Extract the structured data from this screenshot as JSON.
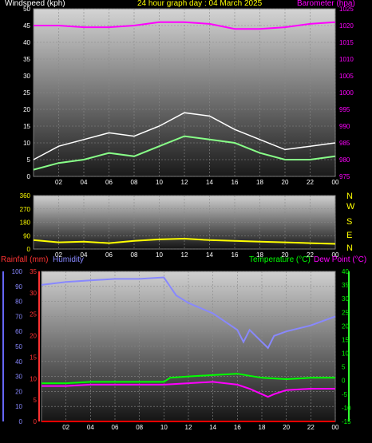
{
  "header": {
    "left": "Windspeed (kph)",
    "center": "24 hour graph day : 04 March 2025",
    "right": "Barometer (hpa)"
  },
  "lower_header": {
    "rain": "Rainfall (mm)",
    "humidity": "Humidity",
    "temperature": "Temperature (°C)",
    "dewpoint": "Dew Point (°C)"
  },
  "compass": [
    "N",
    "W",
    "S",
    "E",
    "N"
  ],
  "colors": {
    "background": "#000000",
    "wind_avg": "#ffffff",
    "wind_gust": "#88ff88",
    "barometer": "#ff00ff",
    "direction": "#ffff00",
    "humidity": "#8888ff",
    "temperature": "#00ff00",
    "dewpoint": "#ff00ff",
    "rain": "#ff0000",
    "axis_left_label": "#ffffff",
    "axis_right_label": "#ff00ff"
  },
  "chart_data": [
    {
      "type": "line",
      "name": "wind_and_pressure",
      "x_ticks": [
        "02",
        "04",
        "06",
        "08",
        "10",
        "12",
        "14",
        "16",
        "18",
        "20",
        "22",
        "00"
      ],
      "y_left": {
        "label": "Windspeed (kph)",
        "ylim": [
          0,
          50
        ],
        "ticks": [
          0,
          5,
          10,
          15,
          20,
          25,
          30,
          35,
          40,
          45,
          50
        ]
      },
      "y_right": {
        "label": "Barometer (hpa)",
        "ylim": [
          975,
          1025
        ],
        "ticks": [
          975,
          980,
          985,
          990,
          995,
          1000,
          1005,
          1010,
          1015,
          1020,
          1025
        ]
      },
      "series": [
        {
          "name": "Barometer",
          "axis": "right",
          "x": [
            0,
            2,
            4,
            6,
            8,
            10,
            12,
            14,
            16,
            18,
            20,
            22,
            24
          ],
          "values": [
            1020,
            1020,
            1019.5,
            1019.5,
            1020,
            1021,
            1021,
            1020.5,
            1019,
            1019,
            1019.5,
            1020.5,
            1021
          ]
        },
        {
          "name": "Windspeed",
          "axis": "left",
          "x": [
            0,
            2,
            4,
            6,
            8,
            10,
            12,
            14,
            16,
            18,
            20,
            22,
            24
          ],
          "values": [
            2,
            4,
            5,
            7,
            6,
            9,
            12,
            11,
            10,
            7,
            5,
            5,
            6
          ]
        },
        {
          "name": "Windspeed (gust)",
          "axis": "left",
          "x": [
            0,
            2,
            4,
            6,
            8,
            10,
            12,
            14,
            16,
            18,
            20,
            22,
            24
          ],
          "values": [
            5,
            9,
            11,
            13,
            12,
            15,
            19,
            18,
            14,
            11,
            8,
            9,
            10
          ]
        }
      ]
    },
    {
      "type": "line",
      "name": "wind_direction",
      "x_ticks": [
        "02",
        "04",
        "06",
        "08",
        "10",
        "12",
        "14",
        "16",
        "18",
        "20",
        "22",
        "00"
      ],
      "y_left": {
        "ylim": [
          0,
          360
        ],
        "ticks": [
          0,
          90,
          180,
          270,
          360
        ]
      },
      "series": [
        {
          "name": "Direction",
          "x": [
            0,
            2,
            4,
            6,
            8,
            10,
            12,
            14,
            16,
            18,
            20,
            22,
            24
          ],
          "values": [
            60,
            45,
            50,
            40,
            55,
            65,
            70,
            60,
            55,
            50,
            45,
            40,
            35
          ]
        }
      ]
    },
    {
      "type": "line",
      "name": "temp_humidity_rain",
      "x_ticks": [
        "02",
        "04",
        "06",
        "08",
        "10",
        "12",
        "14",
        "16",
        "18",
        "20",
        "22",
        "00"
      ],
      "y_left_outer": {
        "label": "Humidity",
        "ylim": [
          0,
          100
        ],
        "ticks": [
          0,
          10,
          20,
          30,
          40,
          50,
          60,
          70,
          80,
          90,
          100
        ]
      },
      "y_left_inner": {
        "label": "Rainfall (mm)",
        "ylim": [
          0,
          35
        ],
        "ticks": [
          0,
          5,
          10,
          15,
          20,
          25,
          30,
          35
        ]
      },
      "y_right": {
        "label": "Temperature (°C)",
        "ylim": [
          -15,
          40
        ],
        "ticks": [
          -15,
          -10,
          -5,
          0,
          5,
          10,
          15,
          20,
          25,
          30,
          35,
          40
        ]
      },
      "series": [
        {
          "name": "Humidity",
          "axis": "left_outer",
          "x": [
            0,
            2,
            4,
            6,
            8,
            10,
            11,
            12,
            14,
            16,
            16.5,
            17,
            18,
            18.5,
            19,
            20,
            22,
            24
          ],
          "values": [
            91,
            93,
            94,
            95,
            95,
            96,
            84,
            79,
            72,
            61,
            53,
            61,
            53,
            49,
            57,
            60,
            64,
            70
          ]
        },
        {
          "name": "Temperature",
          "axis": "right",
          "x": [
            0,
            2,
            4,
            6,
            8,
            10,
            10.5,
            12,
            14,
            16,
            18,
            20,
            22,
            24
          ],
          "values": [
            -1,
            -1,
            -0.5,
            -0.5,
            -0.5,
            -0.5,
            1,
            1.5,
            2,
            2.5,
            1,
            0.5,
            1,
            1
          ]
        },
        {
          "name": "Dew Point",
          "axis": "right",
          "x": [
            0,
            2,
            4,
            6,
            8,
            10,
            12,
            14,
            16,
            17,
            18,
            18.5,
            19,
            20,
            22,
            24
          ],
          "values": [
            -2,
            -2,
            -1.5,
            -1.5,
            -1.5,
            -1.5,
            -1,
            -0.5,
            -1.5,
            -3,
            -5,
            -6,
            -5,
            -3.5,
            -3,
            -3
          ]
        },
        {
          "name": "Rainfall",
          "axis": "left_inner",
          "x": [
            0,
            24
          ],
          "values": [
            0,
            0
          ]
        }
      ]
    }
  ]
}
